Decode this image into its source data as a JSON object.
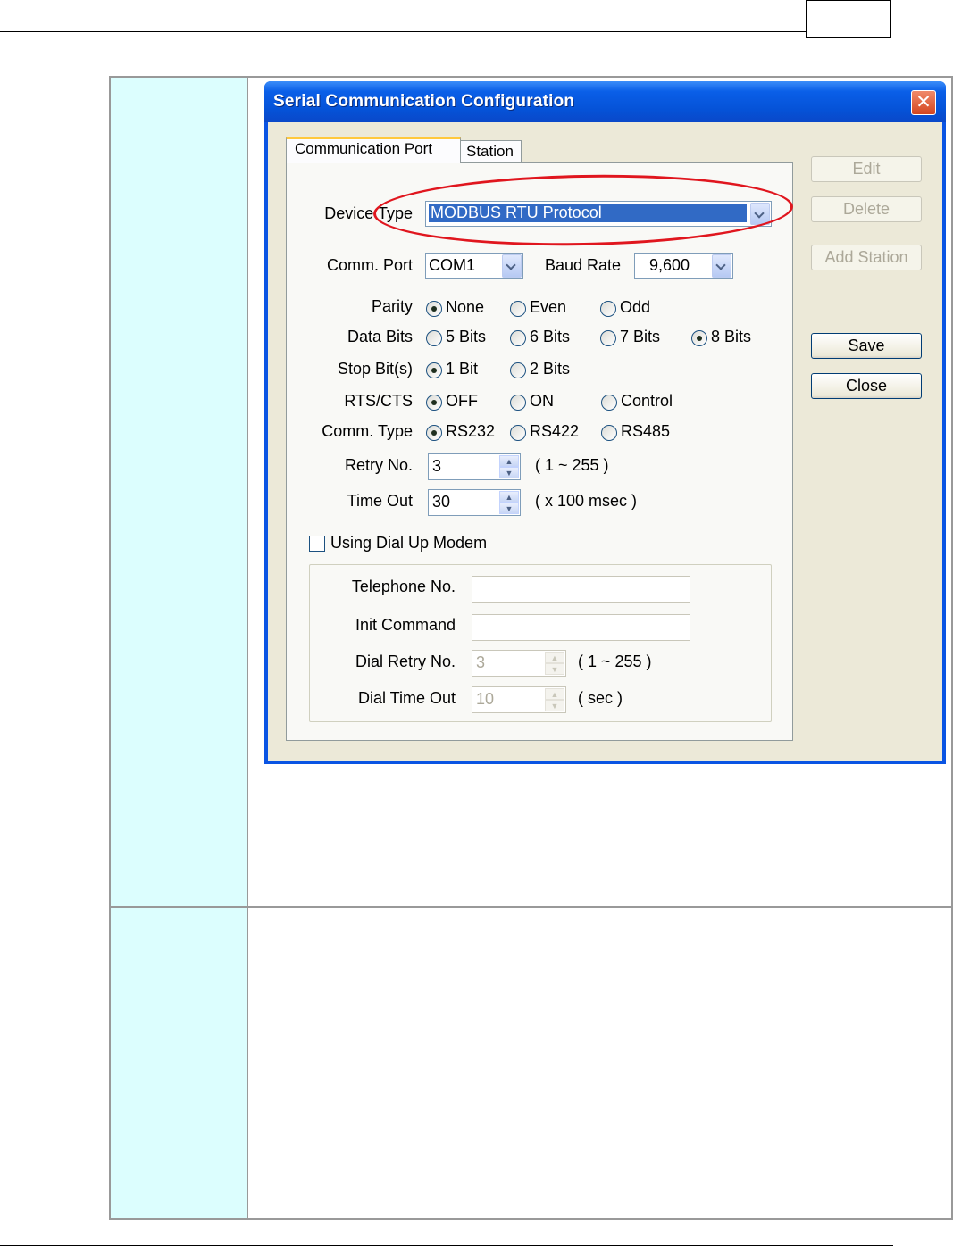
{
  "window": {
    "title": "Serial Communication Configuration",
    "close_glyph": "✕"
  },
  "tabs": [
    {
      "label": "Communication Port",
      "active": true
    },
    {
      "label": "Station",
      "active": false
    }
  ],
  "fields": {
    "device_type": {
      "label": "Device Type",
      "value": "MODBUS RTU Protocol"
    },
    "comm_port": {
      "label": "Comm. Port",
      "value": "COM1"
    },
    "baud_rate": {
      "label": "Baud Rate",
      "value": "9,600"
    },
    "parity": {
      "label": "Parity",
      "options": [
        "None",
        "Even",
        "Odd"
      ],
      "selected": "None"
    },
    "data_bits": {
      "label": "Data Bits",
      "options": [
        "5 Bits",
        "6 Bits",
        "7 Bits",
        "8 Bits"
      ],
      "selected": "8 Bits"
    },
    "stop_bits": {
      "label": "Stop Bit(s)",
      "options": [
        "1 Bit",
        "2 Bits"
      ],
      "selected": "1 Bit"
    },
    "rts_cts": {
      "label": "RTS/CTS",
      "options": [
        "OFF",
        "ON",
        "Control"
      ],
      "selected": "OFF"
    },
    "comm_type": {
      "label": "Comm. Type",
      "options": [
        "RS232",
        "RS422",
        "RS485"
      ],
      "selected": "RS232"
    },
    "retry_no": {
      "label": "Retry No.",
      "value": "3",
      "range": "( 1 ~ 255 )"
    },
    "time_out": {
      "label": "Time Out",
      "value": "30",
      "range": "( x 100 msec )"
    }
  },
  "modem": {
    "checkbox_label": "Using Dial Up Modem",
    "checked": false,
    "telephone_label": "Telephone No.",
    "init_command_label": "Init Command",
    "dial_retry": {
      "label": "Dial Retry No.",
      "value": "3",
      "range": "( 1 ~ 255 )"
    },
    "dial_timeout": {
      "label": "Dial Time Out",
      "value": "10",
      "range": "( sec )"
    }
  },
  "buttons": {
    "edit": "Edit",
    "delete": "Delete",
    "add_station": "Add Station",
    "save": "Save",
    "close": "Close"
  },
  "colors": {
    "titlebar": "#0552d7",
    "highlight_oval": "#e0161e",
    "left_column": "#dcfefe"
  }
}
